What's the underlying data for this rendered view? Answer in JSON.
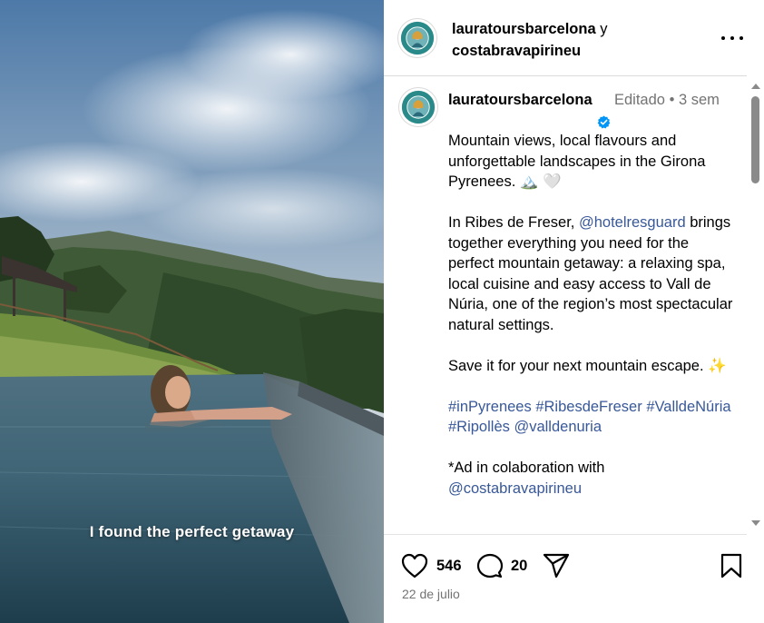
{
  "media": {
    "overlay_text": "I found the perfect getaway"
  },
  "header": {
    "author_primary": "lauratoursbarcelona",
    "joiner": "y",
    "author_secondary": "costabravapirineu",
    "more_icon": "more-horizontal-icon"
  },
  "post": {
    "username": "lauratoursbarcelona",
    "edited_label": "Editado",
    "separator": "•",
    "time_ago": "3 sem",
    "verified_color": "#0095f6",
    "caption": {
      "p1": "Mountain views, local flavours and unforgettable landscapes in the Girona Pyrenees. 🏔️ 🤍",
      "p2_before": "In Ribes de Freser, ",
      "p2_mention": "@hotelresguard",
      "p2_after": " brings together everything you need for the perfect mountain getaway: a relaxing spa, local cuisine and easy access to Vall de Núria, one of the region’s most spectacular natural settings.",
      "p3": "Save it for your next mountain escape. ✨",
      "tags": {
        "t1": "#inPyrenees",
        "t2": "#RibesdeFreser",
        "t3": "#ValldeNúria",
        "t4": "#Ripollès",
        "t5": "@valldenuria"
      },
      "p5_before": "*Ad in colaboration with",
      "p5_mention": "@costabravapirineu"
    }
  },
  "actions": {
    "like_icon": "heart-icon",
    "likes": "546",
    "comment_icon": "comment-icon",
    "comments": "20",
    "share_icon": "share-icon",
    "save_icon": "bookmark-icon",
    "date": "22 de julio"
  },
  "colors": {
    "link": "#385898",
    "muted": "#737373",
    "divider": "#dbdbdb"
  }
}
